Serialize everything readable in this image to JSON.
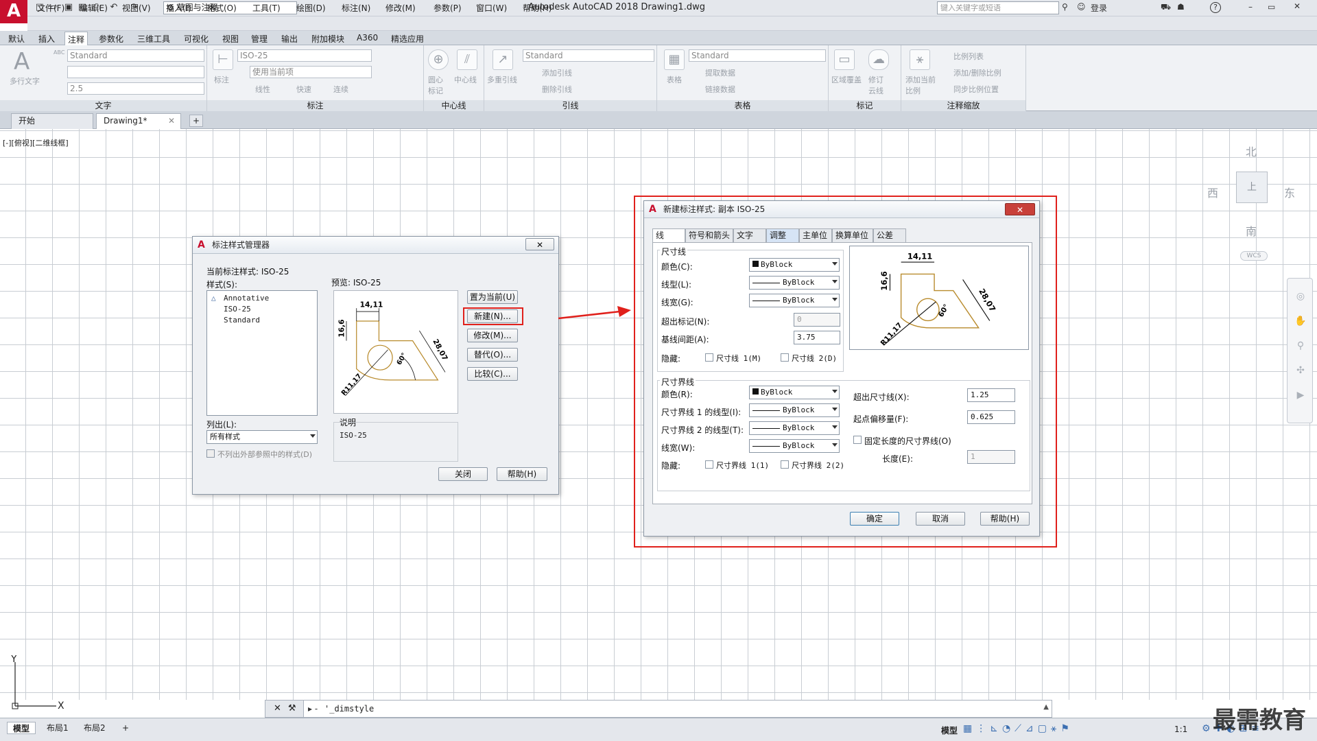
{
  "app": {
    "logo": "A",
    "title": "Autodesk AutoCAD 2018    Drawing1.dwg",
    "workspace": "草图与注释",
    "search_placeholder": "键入关键字或短语",
    "login": "登录",
    "help": "?"
  },
  "menus": [
    "文件(F)",
    "编辑(E)",
    "视图(V)",
    "插入(I)",
    "格式(O)",
    "工具(T)",
    "绘图(D)",
    "标注(N)",
    "修改(M)",
    "参数(P)",
    "窗口(W)",
    "帮助(H)"
  ],
  "ribbon_tabs": [
    "默认",
    "插入",
    "注释",
    "参数化",
    "三维工具",
    "可视化",
    "视图",
    "管理",
    "输出",
    "附加模块",
    "A360",
    "精选应用"
  ],
  "ribbon": {
    "text_panel": {
      "title": "文字",
      "big_label": "多行文字",
      "style": "Standard",
      "height": "2.5",
      "abc": "ABC"
    },
    "dim_panel": {
      "title": "标注",
      "style": "ISO-25",
      "layer": "使用当前项",
      "btn_label": "标注",
      "linear": "线性",
      "quick": "快速",
      "continue": "连续"
    },
    "center_panel": {
      "title": "中心线",
      "center_mark": "圆心标记",
      "centerline": "中心线"
    },
    "leader_panel": {
      "title": "引线",
      "style": "Standard",
      "multileader": "多重引线",
      "add": "添加引线",
      "remove": "删除引线"
    },
    "table_panel": {
      "title": "表格",
      "style": "Standard",
      "table": "表格",
      "extract": "提取数据",
      "link": "链接数据"
    },
    "markup_panel": {
      "title": "标记",
      "wipeout": "区域覆盖",
      "revcloud": "修订云线"
    },
    "scale_panel": {
      "title": "注释缩放",
      "add_scale": "添加当前比例",
      "scale_list": "比例列表",
      "add_delete": "添加/删除比例",
      "sync": "同步比例位置"
    }
  },
  "doc_tabs": [
    "开始",
    "Drawing1*"
  ],
  "viewport_label": "[-][俯视][二维线框]",
  "viewcube": {
    "n": "北",
    "s": "南",
    "e": "东",
    "w": "西",
    "top": "上",
    "wcs": "WCS"
  },
  "ucs": {
    "x": "X",
    "y": "Y"
  },
  "command": {
    "text": "'_dimstyle"
  },
  "status": {
    "tabs": [
      "模型",
      "布局1",
      "布局2"
    ],
    "model": "模型",
    "scale": "1:1"
  },
  "watermark": "最需教育",
  "dsm": {
    "title": "标注样式管理器",
    "current": "当前标注样式: ISO-25",
    "styles_label": "样式(S):",
    "styles": [
      "Annotative",
      "ISO-25",
      "Standard"
    ],
    "preview_label": "预览: ISO-25",
    "list_label": "列出(L):",
    "list_value": "所有样式",
    "xref_label": "不列出外部参照中的样式(D)",
    "desc_label": "说明",
    "desc_value": "ISO-25",
    "buttons": {
      "set_current": "置为当前(U)",
      "new": "新建(N)...",
      "modify": "修改(M)...",
      "override": "替代(O)...",
      "compare": "比较(C)...",
      "close": "关闭",
      "help": "帮助(H)"
    }
  },
  "preview_dims": {
    "top": "14,11",
    "left": "16,6",
    "right": "28,07",
    "angle": "60°",
    "radius": "R11,17"
  },
  "nds": {
    "title": "新建标注样式: 副本 ISO-25",
    "tabs": [
      "线",
      "符号和箭头",
      "文字",
      "调整",
      "主单位",
      "换算单位",
      "公差"
    ],
    "dim_lines": {
      "group": "尺寸线",
      "color_label": "颜色(C):",
      "color": "ByBlock",
      "ltype_label": "线型(L):",
      "ltype": "ByBlock",
      "lweight_label": "线宽(G):",
      "lweight": "ByBlock",
      "extend_label": "超出标记(N):",
      "extend": "0",
      "baseline_label": "基线间距(A):",
      "baseline": "3.75",
      "suppress_label": "隐藏:",
      "sup1": "尺寸线 1(M)",
      "sup2": "尺寸线 2(D)"
    },
    "ext_lines": {
      "group": "尺寸界线",
      "color_label": "颜色(R):",
      "color": "ByBlock",
      "lt1_label": "尺寸界线 1 的线型(I):",
      "lt1": "ByBlock",
      "lt2_label": "尺寸界线 2 的线型(T):",
      "lt2": "ByBlock",
      "lweight_label": "线宽(W):",
      "lweight": "ByBlock",
      "suppress_label": "隐藏:",
      "sup1": "尺寸界线 1(1)",
      "sup2": "尺寸界线 2(2)",
      "beyond_label": "超出尺寸线(X):",
      "beyond": "1.25",
      "offset_label": "起点偏移量(F):",
      "offset": "0.625",
      "fixed_label": "固定长度的尺寸界线(O)",
      "length_label": "长度(E):",
      "length": "1"
    },
    "buttons": {
      "ok": "确定",
      "cancel": "取消",
      "help": "帮助(H)"
    }
  }
}
